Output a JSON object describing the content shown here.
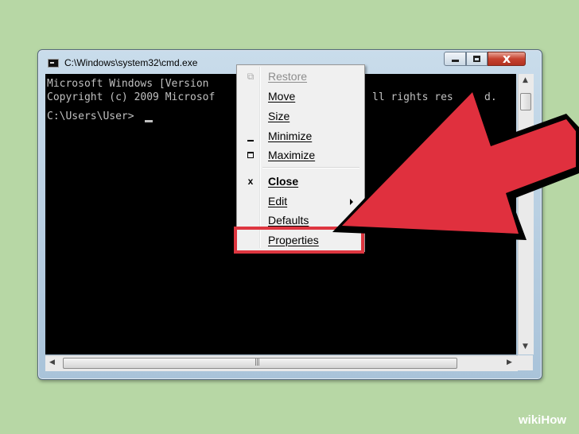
{
  "window": {
    "title": "C:\\Windows\\system32\\cmd.exe",
    "close_glyph": "x"
  },
  "console": {
    "lines": [
      "Microsoft Windows [Version",
      "Copyright (c) 2009 Microsof",
      "",
      "C:\\Users\\User>"
    ],
    "hidden_right_fragments": [
      "ll rights res",
      "d."
    ]
  },
  "context_menu": {
    "items": [
      {
        "label": "Restore",
        "icon": "restore-icon",
        "state": "disabled"
      },
      {
        "label": "Move",
        "icon": "",
        "state": "enabled"
      },
      {
        "label": "Size",
        "icon": "",
        "state": "enabled"
      },
      {
        "label": "Minimize",
        "icon": "minimize-icon",
        "state": "enabled"
      },
      {
        "label": "Maximize",
        "icon": "maximize-icon",
        "state": "enabled"
      },
      {
        "label": "Close",
        "icon": "close-icon",
        "state": "default"
      },
      {
        "label": "Edit",
        "icon": "",
        "state": "submenu"
      },
      {
        "label": "Defaults",
        "icon": "",
        "state": "enabled"
      },
      {
        "label": "Properties",
        "icon": "",
        "state": "highlighted"
      }
    ]
  },
  "annotation": {
    "highlight_color": "#de3640",
    "arrow_color": "#e0303e"
  },
  "watermark": {
    "part1": "wiki",
    "part2": "How"
  },
  "colors": {
    "background": "#b7d7a5",
    "console_bg": "#000000",
    "console_text": "#c0c0c0"
  }
}
